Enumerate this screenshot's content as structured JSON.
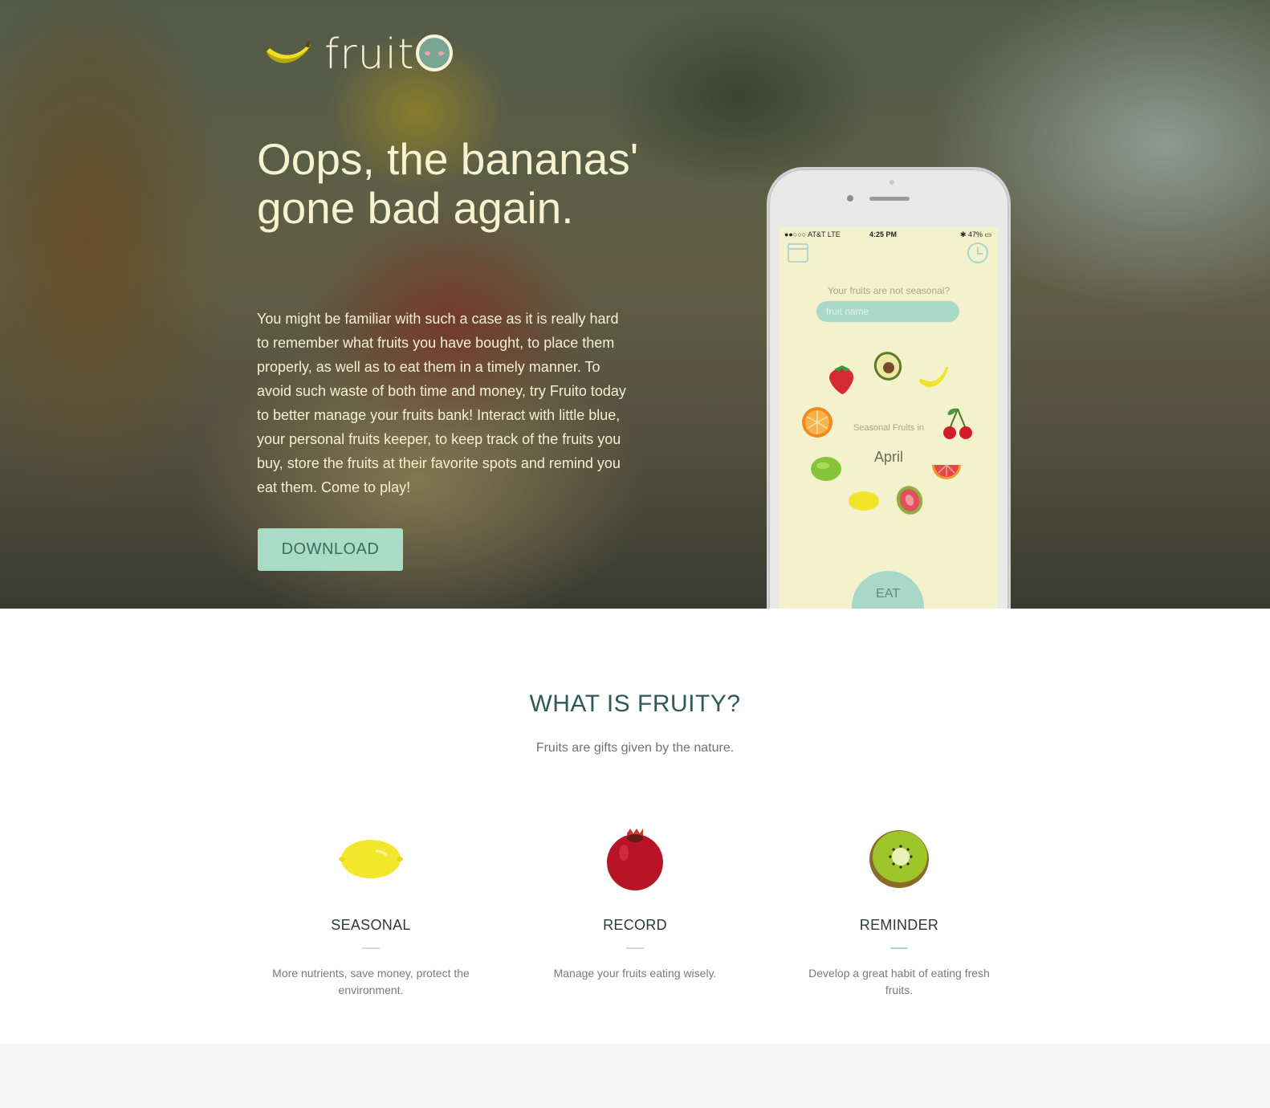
{
  "brand": {
    "logo_text": "fruit",
    "accent": "#a8d9c8",
    "cream": "#f7f3d0"
  },
  "hero": {
    "headline": "Oops, the bananas' gone bad again.",
    "intro": "You might be familiar with such a case as it is really hard to remember what fruits you have bought, to place them properly, as well as to eat them in a timely manner. To avoid such waste of both time and money, try Fruito today to better manage your fruits bank! Interact with little blue, your personal fruits keeper, to keep track of the fruits you buy, store the fruits at their favorite spots and remind you eat them. Come to play!",
    "download_label": "DOWNLOAD"
  },
  "phone": {
    "status": {
      "carrier": "●●○○○ AT&T  LTE",
      "time": "4:25 PM",
      "battery": "✱ 47% ▭"
    },
    "question": "Your fruits are not seasonal?",
    "input_placeholder": "fruit name",
    "seasonal_label": "Seasonal Fruits in",
    "month": "April",
    "eat_label": "EAT",
    "fruits": [
      "strawberry",
      "avocado",
      "banana",
      "orange",
      "cherry",
      "lime",
      "grapefruit",
      "lemon",
      "guava"
    ]
  },
  "what": {
    "title": "WHAT IS FRUITY?",
    "subtitle": "Fruits are gifts given by the nature.",
    "features": [
      {
        "icon": "lemon-icon",
        "title": "SEASONAL",
        "desc": "More nutrients, save money, protect the environment."
      },
      {
        "icon": "pomegranate-icon",
        "title": "RECORD",
        "desc": "Manage your fruits eating wisely."
      },
      {
        "icon": "kiwi-icon",
        "title": "REMINDER",
        "desc": "Develop a great habit of eating fresh fruits."
      }
    ]
  }
}
